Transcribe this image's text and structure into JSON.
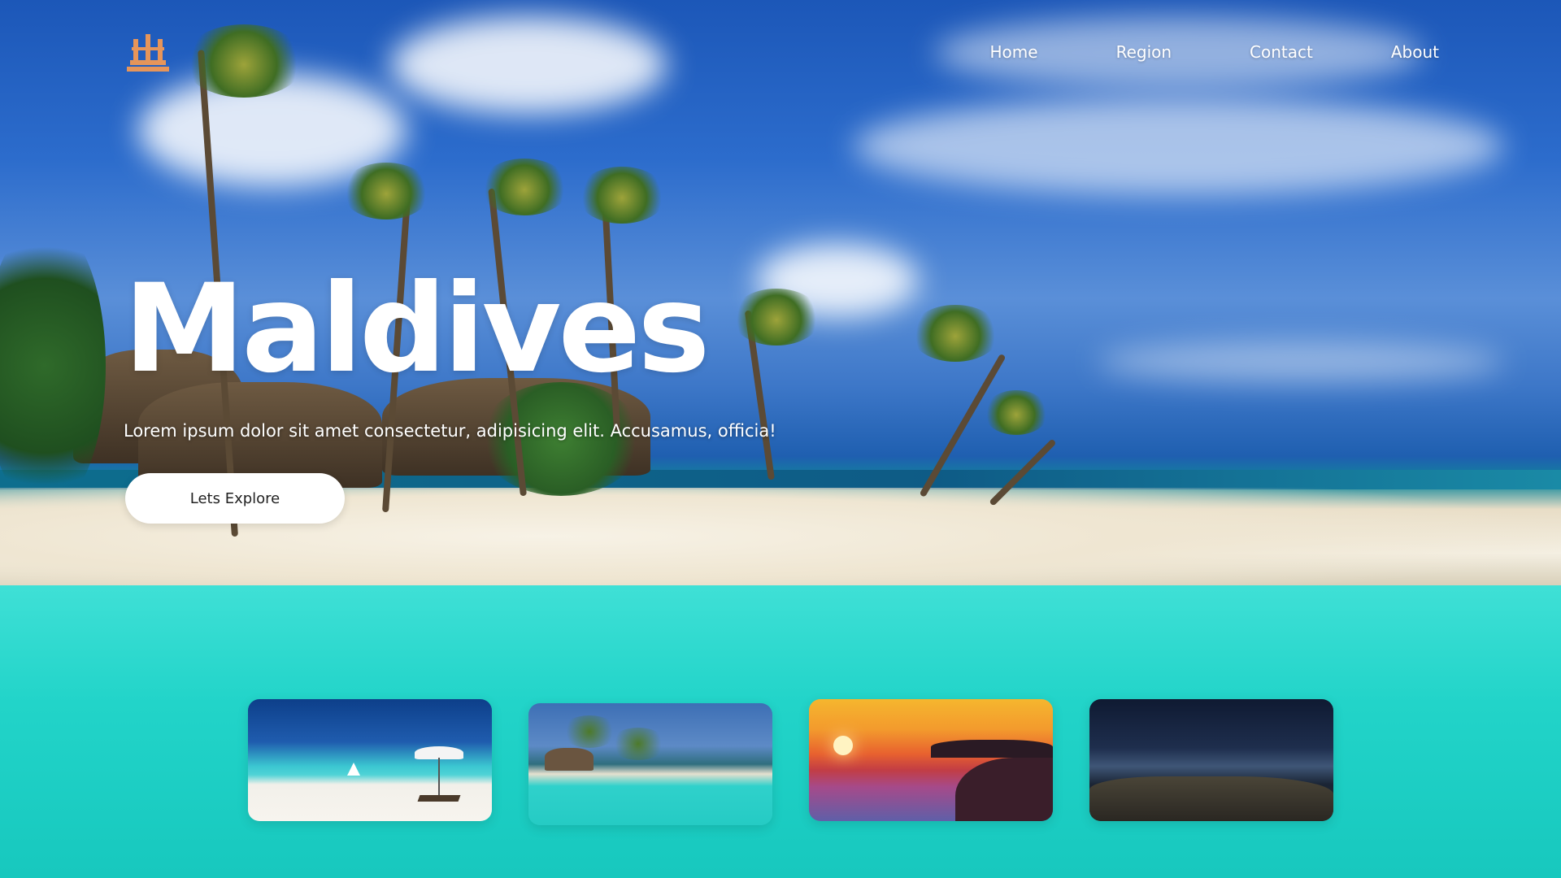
{
  "brand": {
    "logo_icon": "temple-logo-icon",
    "logo_color": "#e6955a"
  },
  "nav": {
    "items": [
      {
        "label": "Home"
      },
      {
        "label": "Region"
      },
      {
        "label": "Contact"
      },
      {
        "label": "About"
      }
    ]
  },
  "hero": {
    "title": "Maldives",
    "subtitle": "Lorem ipsum dolor sit amet consectetur, adipisicing elit. Accusamus, officia!",
    "cta_label": "Lets Explore"
  },
  "gallery": {
    "cards": [
      {
        "name": "beach-umbrella-card"
      },
      {
        "name": "palm-resort-card"
      },
      {
        "name": "sunset-shore-card"
      },
      {
        "name": "night-coast-card"
      }
    ]
  },
  "colors": {
    "sky": "#2c6ccc",
    "lagoon": "#22d4c9",
    "text": "#ffffff",
    "button_bg": "#ffffff",
    "button_text": "#222222"
  }
}
